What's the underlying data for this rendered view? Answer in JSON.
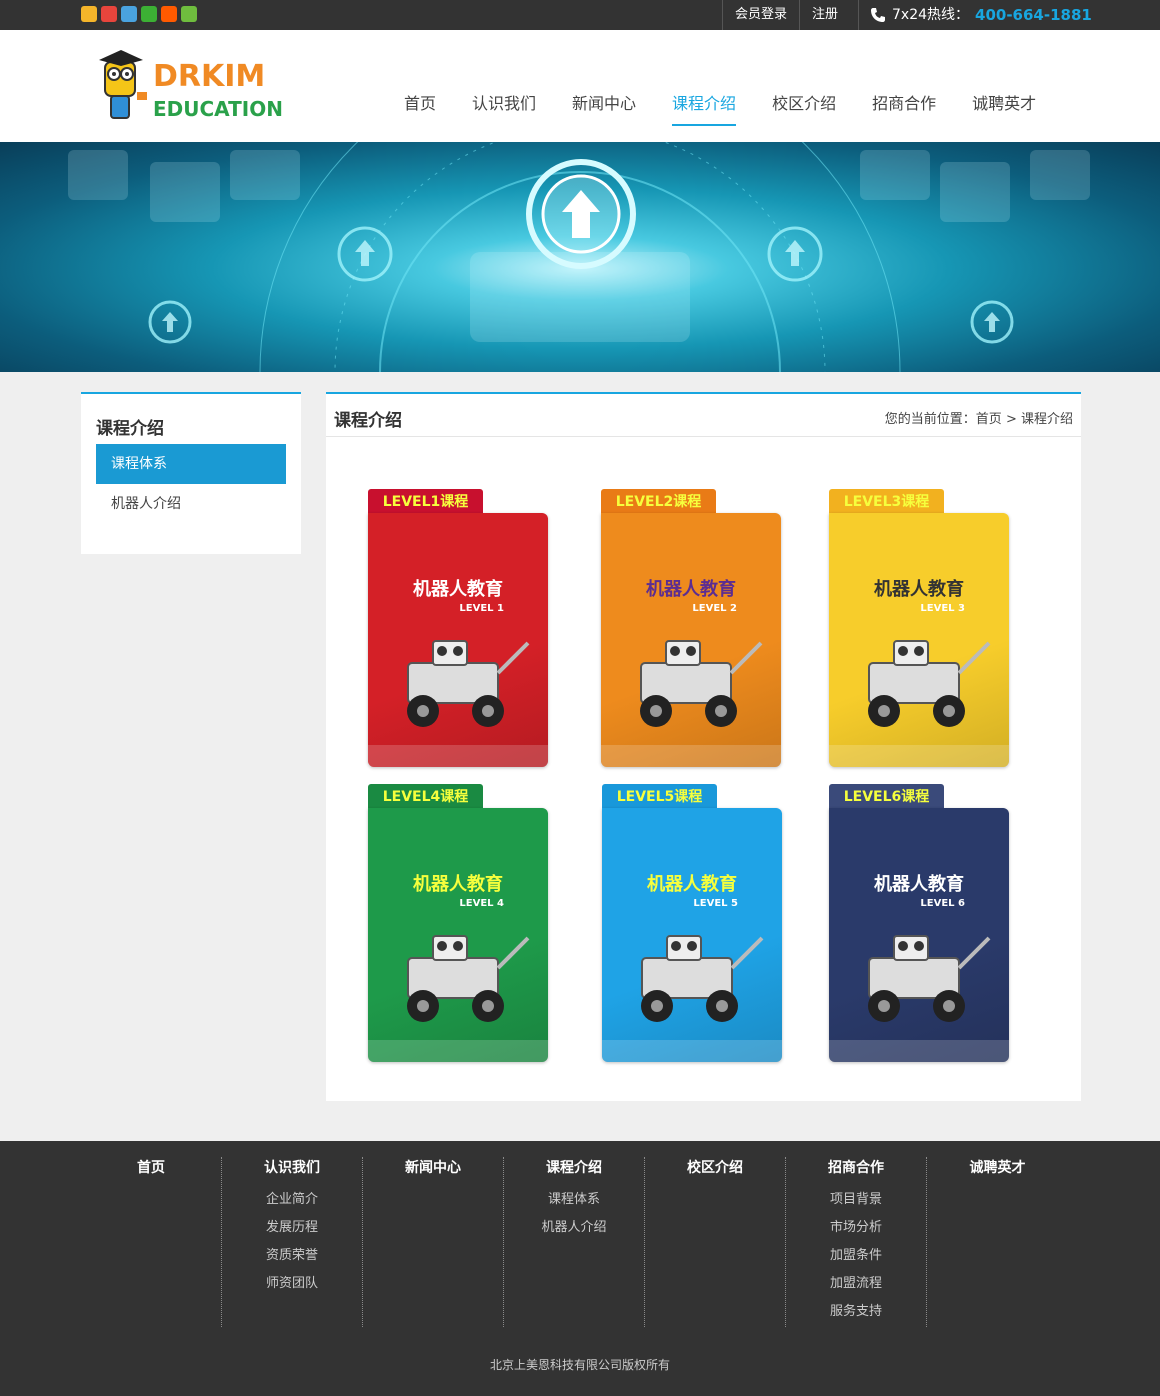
{
  "topbar": {
    "login_label": "会员登录",
    "register_label": "注册",
    "hotline_label": "7x24热线：",
    "hotline_number": "400-664-1881",
    "share_icons": [
      {
        "name": "qzone-icon",
        "color": "#f5b52a"
      },
      {
        "name": "weibo-icon",
        "color": "#e8453c"
      },
      {
        "name": "tencent-weibo-icon",
        "color": "#4aa3df"
      },
      {
        "name": "wechat-icon",
        "color": "#3cb034"
      },
      {
        "name": "taobao-icon",
        "color": "#ff5a00"
      },
      {
        "name": "more-share-icon",
        "color": "#6fbd3e"
      }
    ]
  },
  "header": {
    "logo_text_top": "DRKIM",
    "logo_text_bottom": "EDUCATION",
    "nav": [
      {
        "label": "首页",
        "active": false
      },
      {
        "label": "认识我们",
        "active": false
      },
      {
        "label": "新闻中心",
        "active": false
      },
      {
        "label": "课程介绍",
        "active": true
      },
      {
        "label": "校区介绍",
        "active": false
      },
      {
        "label": "招商合作",
        "active": false
      },
      {
        "label": "诚聘英才",
        "active": false
      }
    ]
  },
  "sidebar": {
    "title": "课程介绍",
    "items": [
      {
        "label": "课程体系",
        "active": true
      },
      {
        "label": "机器人介绍",
        "active": false
      }
    ]
  },
  "content": {
    "title": "课程介绍",
    "breadcrumb_prefix": "您的当前位置：",
    "breadcrumb_home": "首页",
    "breadcrumb_sep": ">",
    "breadcrumb_current": "课程介绍",
    "courses": [
      {
        "tab": "LEVEL1课程",
        "level": "LEVEL 1",
        "title": "机器人教育",
        "color": "#d42027",
        "tab_color": "#c8102e",
        "title_color": "#fff"
      },
      {
        "tab": "LEVEL2课程",
        "level": "LEVEL 2",
        "title": "机器人教育",
        "color": "#ee8b1d",
        "tab_color": "#e97b16",
        "title_color": "#5c2d91"
      },
      {
        "tab": "LEVEL3课程",
        "level": "LEVEL 3",
        "title": "机器人教育",
        "color": "#f7cd2b",
        "tab_color": "#f2b11f",
        "title_color": "#333"
      },
      {
        "tab": "LEVEL4课程",
        "level": "LEVEL 4",
        "title": "机器人教育",
        "color": "#1e9a4a",
        "tab_color": "#1a8a42",
        "title_color": "#f6ff3d"
      },
      {
        "tab": "LEVEL5课程",
        "level": "LEVEL 5",
        "title": "机器人教育",
        "color": "#1fa3e6",
        "tab_color": "#1998da",
        "title_color": "#f6ff3d"
      },
      {
        "tab": "LEVEL6课程",
        "level": "LEVEL 6",
        "title": "机器人教育",
        "color": "#2a3a6a",
        "tab_color": "#3a4a7a",
        "title_color": "#fff"
      }
    ]
  },
  "footer": {
    "columns": [
      {
        "title": "首页",
        "links": []
      },
      {
        "title": "认识我们",
        "links": [
          "企业简介",
          "发展历程",
          "资质荣誉",
          "师资团队"
        ]
      },
      {
        "title": "新闻中心",
        "links": []
      },
      {
        "title": "课程介绍",
        "links": [
          "课程体系",
          "机器人介绍"
        ]
      },
      {
        "title": "校区介绍",
        "links": []
      },
      {
        "title": "招商合作",
        "links": [
          "项目背景",
          "市场分析",
          "加盟条件",
          "加盟流程",
          "服务支持"
        ]
      },
      {
        "title": "诚聘英才",
        "links": []
      }
    ],
    "copyright": "北京上美恩科技有限公司版权所有"
  }
}
